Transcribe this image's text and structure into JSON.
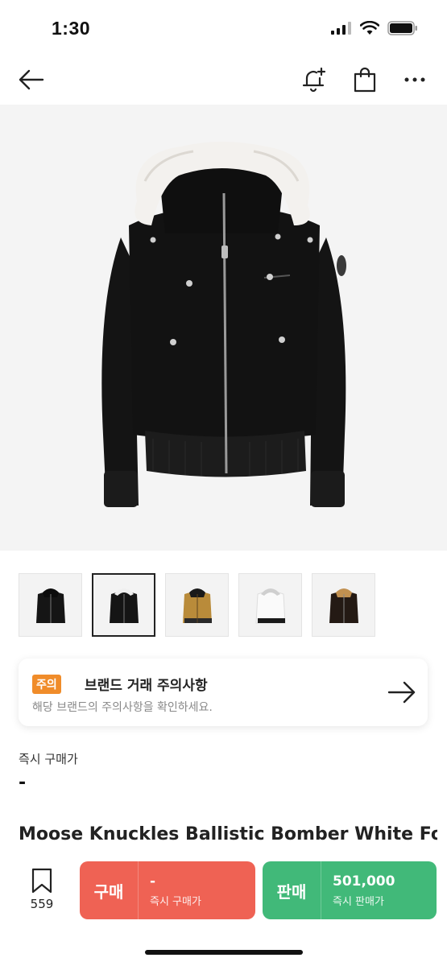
{
  "status_bar": {
    "time": "1:30"
  },
  "nav": {
    "back_icon": "arrow-left-icon",
    "alert_icon": "bell-plus-icon",
    "bag_icon": "shopping-bag-icon",
    "more_icon": "more-horizontal-icon"
  },
  "thumbnails": [
    {
      "variant": "black-hood-black-fur",
      "selected": false
    },
    {
      "variant": "black-white-fur",
      "selected": true
    },
    {
      "variant": "tan",
      "selected": false
    },
    {
      "variant": "white",
      "selected": false
    },
    {
      "variant": "dark-brown",
      "selected": false
    }
  ],
  "notice": {
    "badge": "주의",
    "title": "브랜드 거래 주의사항",
    "subtitle": "해당 브랜드의 주의사항을 확인하세요."
  },
  "instant": {
    "label": "즉시 구매가",
    "value": "-"
  },
  "product": {
    "title": "Moose Knuckles Ballistic Bomber White Fox Fur Black"
  },
  "bottom": {
    "wish_count": "559",
    "buy": {
      "label": "구매",
      "price": "-",
      "sub": "즉시 구매가"
    },
    "sell": {
      "label": "판매",
      "price": "501,000",
      "sub": "즉시 판매가"
    }
  },
  "colors": {
    "buy": "#ef6254",
    "sell": "#41b979",
    "badge": "#f08c2a"
  }
}
